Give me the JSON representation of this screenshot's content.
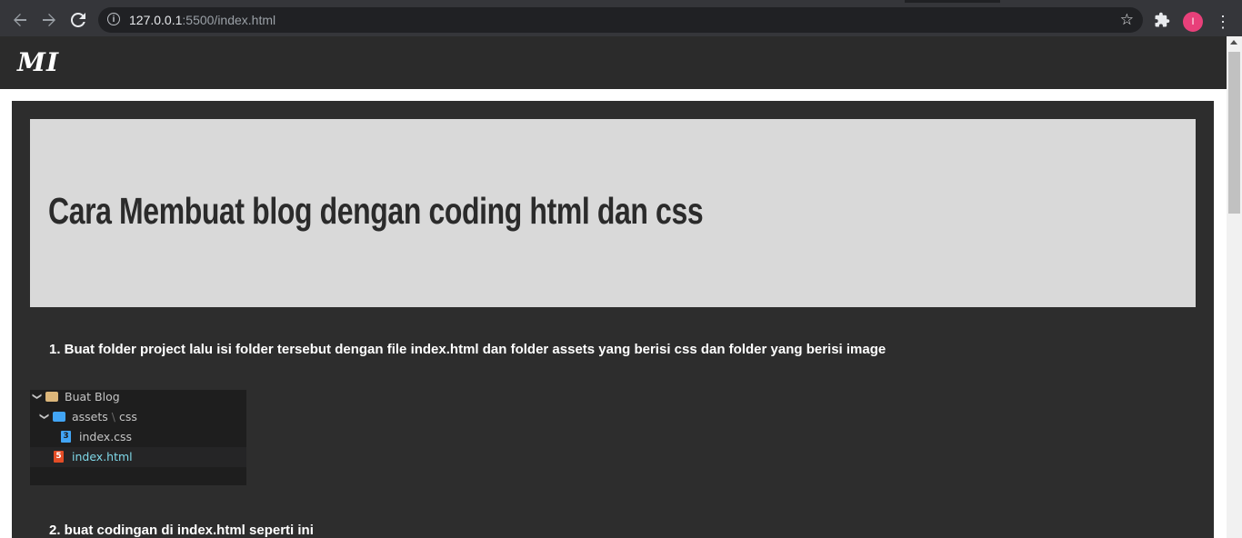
{
  "browser": {
    "url_host": "127.0.0.1",
    "url_rest": ":5500/index.html",
    "avatar_initial": "I",
    "accent": "#e8407a"
  },
  "site": {
    "logo": "MI"
  },
  "article": {
    "title": "Cara Membuat blog dengan coding html dan css",
    "step1": "1. Buat folder project lalu isi folder tersebut dengan file index.html dan folder assets yang berisi css dan folder yang berisi image",
    "step2": "2. buat codingan di index.html seperti ini"
  },
  "explorer": {
    "root": "Buat Blog",
    "folder_assets": "assets",
    "folder_sep": "\\",
    "folder_css": "css",
    "file_css": "index.css",
    "file_html": "index.html",
    "css_badge": "3",
    "html_badge": "5"
  }
}
